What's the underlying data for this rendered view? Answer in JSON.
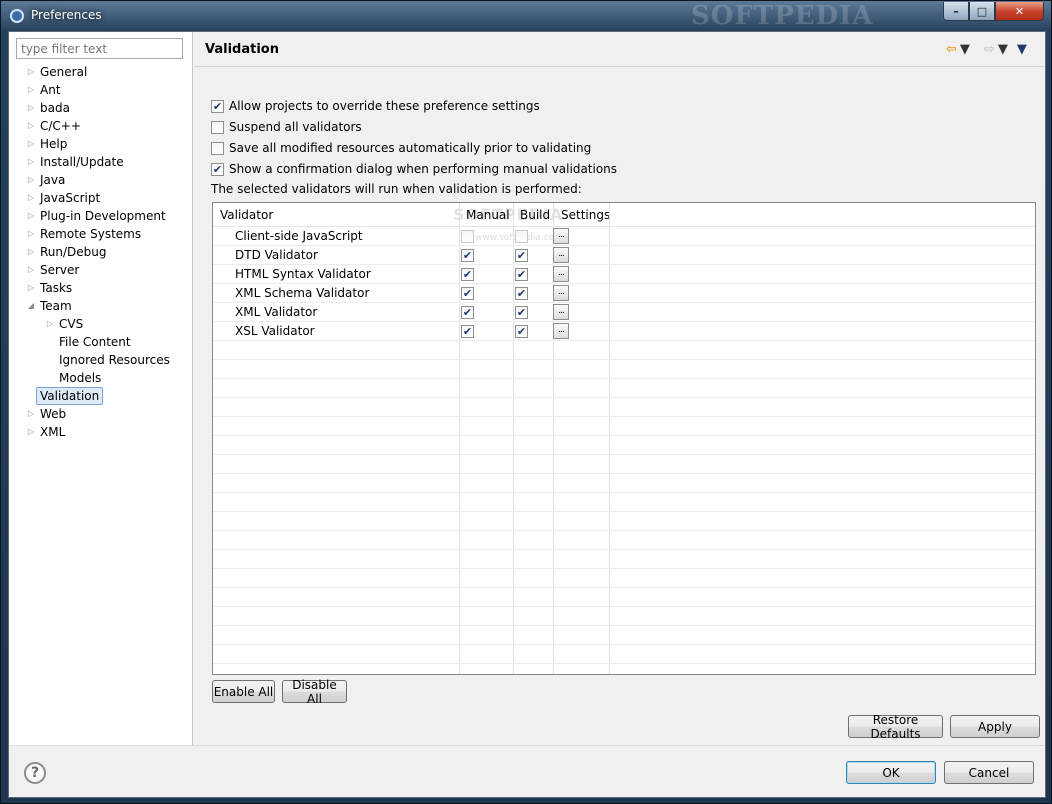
{
  "window": {
    "title": "Preferences",
    "watermark": "SOFTPEDIA",
    "min_glyph": "–",
    "max_glyph": "□",
    "close_glyph": "✕"
  },
  "nav": {
    "filter_placeholder": "type filter text",
    "items": [
      {
        "label": "General"
      },
      {
        "label": "Ant"
      },
      {
        "label": "bada"
      },
      {
        "label": "C/C++"
      },
      {
        "label": "Help"
      },
      {
        "label": "Install/Update"
      },
      {
        "label": "Java"
      },
      {
        "label": "JavaScript"
      },
      {
        "label": "Plug-in Development"
      },
      {
        "label": "Remote Systems"
      },
      {
        "label": "Run/Debug"
      },
      {
        "label": "Server"
      },
      {
        "label": "Tasks"
      },
      {
        "label": "Team"
      },
      {
        "label": "CVS"
      },
      {
        "label": "File Content"
      },
      {
        "label": "Ignored Resources"
      },
      {
        "label": "Models"
      },
      {
        "label": "Validation"
      },
      {
        "label": "Web"
      },
      {
        "label": "XML"
      }
    ]
  },
  "page": {
    "title": "Validation",
    "options": [
      {
        "label": "Allow projects to override these preference settings",
        "checked": true
      },
      {
        "label": "Suspend all validators",
        "checked": false
      },
      {
        "label": "Save all modified resources automatically prior to validating",
        "checked": false
      },
      {
        "label": "Show a confirmation dialog when performing manual validations",
        "checked": true
      }
    ],
    "run_label": "The selected validators will run when validation is performed:"
  },
  "table": {
    "headers": {
      "validator": "Validator",
      "manual": "Manual",
      "build": "Build",
      "settings": "Settings"
    },
    "watermark": "SOFTPEDIA",
    "watermark_url": "www.softpedia.com",
    "settings_glyph": "...",
    "rows": [
      {
        "name": "Client-side JavaScript",
        "manual": false,
        "build": false
      },
      {
        "name": "DTD Validator",
        "manual": true,
        "build": true
      },
      {
        "name": "HTML Syntax Validator",
        "manual": true,
        "build": true
      },
      {
        "name": "XML Schema Validator",
        "manual": true,
        "build": true
      },
      {
        "name": "XML Validator",
        "manual": true,
        "build": true
      },
      {
        "name": "XSL Validator",
        "manual": true,
        "build": true
      }
    ]
  },
  "buttons": {
    "enable_all": "Enable All",
    "disable_all": "Disable All",
    "restore_defaults": "Restore Defaults",
    "apply": "Apply",
    "ok": "OK",
    "cancel": "Cancel"
  },
  "icons": {
    "help": "?",
    "check": "✔"
  }
}
